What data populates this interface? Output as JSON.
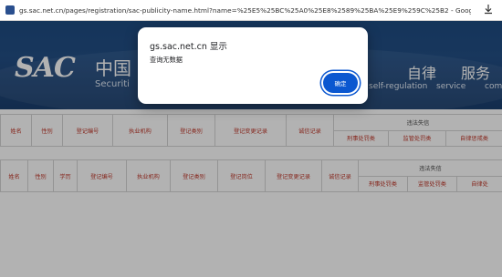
{
  "browser": {
    "url": "gs.sac.net.cn/pages/registration/sac-publicity-name.html?name=%25E5%25BC%25A0%25E8%2589%25BA%25E9%259C%25B2 - Google Chrome",
    "icons": {
      "favicon": "site-favicon",
      "download": "download-icon"
    }
  },
  "header": {
    "logo_text": "SAC",
    "logo_cn": "中国",
    "logo_en": "Securiti",
    "slogan_cn_1": "自律",
    "slogan_cn_2": "服务",
    "slogan_en_1": "self-regulation",
    "slogan_en_2": "service",
    "slogan_en_3": "com"
  },
  "table1": {
    "headers": [
      "姓名",
      "性别",
      "登记编号",
      "执业机构",
      "登记类别",
      "登记变更记录",
      "诚信记录"
    ],
    "group_header": "违法失信",
    "sub_headers": [
      "刑事处罚类",
      "监管处罚类",
      "自律惩戒类"
    ]
  },
  "table2": {
    "headers": [
      "姓名",
      "性别",
      "学历",
      "登记编号",
      "执业机构",
      "登记类别",
      "登记岗位",
      "登记变更记录",
      "诚信记录"
    ],
    "group_header": "违法失信",
    "sub_headers": [
      "刑事处罚类",
      "监管处罚类",
      "自律处"
    ]
  },
  "dialog": {
    "title": "gs.sac.net.cn 显示",
    "message": "查询无数据",
    "ok_label": "确定"
  },
  "colors": {
    "accent": "#0b57d0",
    "header_blue": "#1e4c82",
    "table_text": "#c0392b"
  }
}
